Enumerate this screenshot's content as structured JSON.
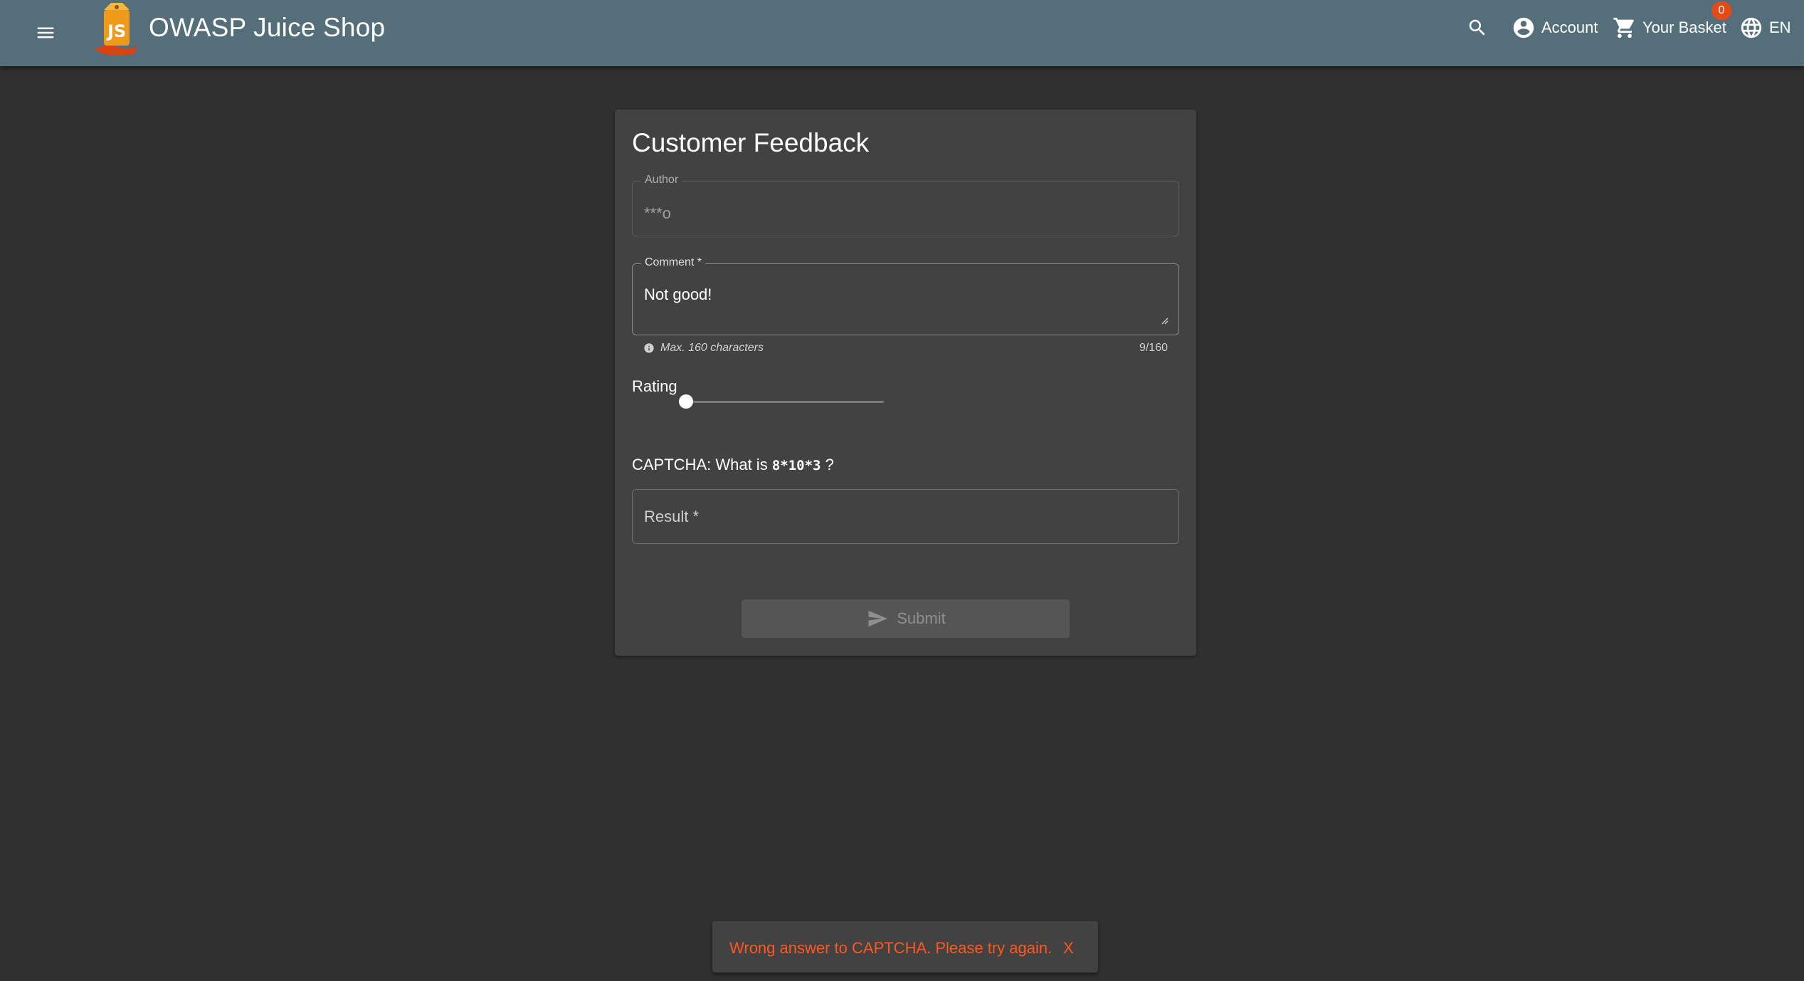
{
  "header": {
    "title": "OWASP Juice Shop",
    "logo_text": "JS",
    "account_label": "Account",
    "basket_label": "Your Basket",
    "basket_count": "0",
    "language_label": "EN",
    "bar_color": "#546e7a",
    "badge_color": "#e64a19"
  },
  "form": {
    "title": "Customer Feedback",
    "author_label": "Author",
    "author_value": "***o",
    "comment_label": "Comment *",
    "comment_value": "Not good!",
    "comment_hint": "Max. 160 characters",
    "comment_counter": "9/160",
    "rating_label": "Rating",
    "rating_value": 1,
    "rating_min": 1,
    "rating_max": 5,
    "captcha_prefix": "CAPTCHA:  What is ",
    "captcha_expression": "8*10*3",
    "captcha_suffix": " ?",
    "result_label": "Result *",
    "submit_label": "Submit"
  },
  "snackbar": {
    "message": "Wrong answer to CAPTCHA. Please try again.",
    "close_label": "X",
    "text_color": "#ff5722"
  }
}
